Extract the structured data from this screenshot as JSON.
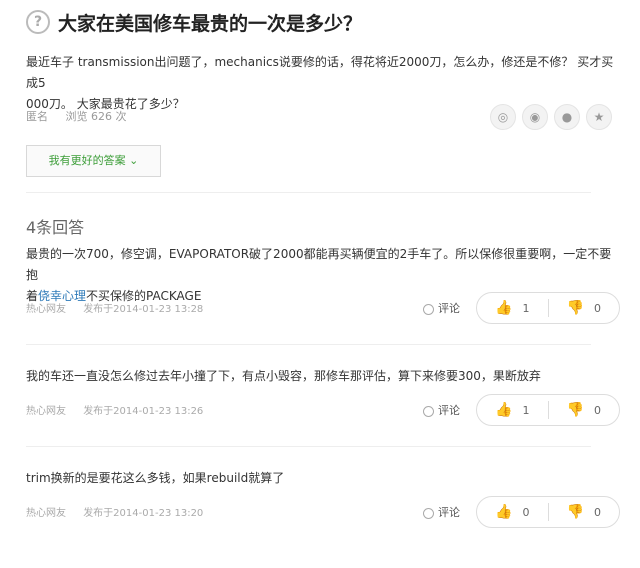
{
  "question": {
    "title": "大家在美国修车最贵的一次是多少？",
    "description_line1": "最近车子 transmission出问题了，mechanics说要修的话，得花将近2000刀，怎么办，修还是不修？ 买才买成5",
    "description_line2": "000刀。 大家最贵花了多少？",
    "author": "匿名",
    "views": "浏览 626 次"
  },
  "share_icons": [
    "wechat-icon",
    "weibo-icon",
    "qq-icon",
    "favorite-star-icon"
  ],
  "answer_button_label": "我有更好的答案",
  "answers_count_label": "4条回答",
  "answers": [
    {
      "text_part1": "最贵的一次700，修空调，EVAPORATOR破了2000都能再买辆便宜的2手车了。所以保修很重要啊，一定不要抱",
      "text_part2": "着",
      "text_link": "侥幸心理",
      "text_part3": "不买保修的PACKAGE",
      "author": "热心网友",
      "time": "发布于2014-01-23 13:28",
      "comment_label": "评论",
      "up": "1",
      "down": "0"
    },
    {
      "text_part1": "我的车还一直没怎么修过去年小撞了下，有点小毁容，那修车那评估，算下来修要300，果断放弃",
      "author": "热心网友",
      "time": "发布于2014-01-23 13:26",
      "comment_label": "评论",
      "up": "1",
      "down": "0"
    },
    {
      "text_part1": "trim换新的是要花这么多钱，如果rebuild就算了",
      "author": "热心网友",
      "time": "发布于2014-01-23 13:20",
      "comment_label": "评论",
      "up": "0",
      "down": "0"
    }
  ]
}
